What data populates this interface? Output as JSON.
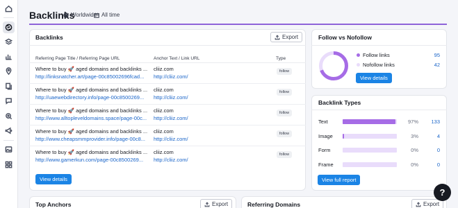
{
  "header": {
    "title": "Backlinks",
    "scope": "Worldwide",
    "period": "All time"
  },
  "sidebar": {
    "icons": [
      "home-icon",
      "backlinks-icon",
      "layers-icon",
      "chart-icon",
      "pin-icon",
      "pages-icon",
      "chat-icon",
      "search-target-icon",
      "megaphone-icon",
      "image-icon",
      "grid-icon"
    ]
  },
  "backlinks": {
    "title": "Backlinks",
    "export_label": "Export",
    "columns": {
      "referring": "Referring Page Title / Referring Page URL",
      "anchor": "Anchor Text / Link URL",
      "type": "Type"
    },
    "rows": [
      {
        "title": "Where to buy 🚀 aged domains and backlinks ...",
        "url": "http://linksnatcher.art/page-00c85002696fcad...",
        "anchor": "cliiz.com",
        "link": "http://cliiz.com/",
        "type": "follow"
      },
      {
        "title": "Where to buy 🚀 aged domains and backlinks ...",
        "url": "http://uaewebdirectory.info/page-00c8500269...",
        "anchor": "cliiz.com",
        "link": "http://cliiz.com/",
        "type": "follow"
      },
      {
        "title": "Where to buy 🚀 aged domains and backlinks ...",
        "url": "http://www.alltopleveldomains.space/page-00c...",
        "anchor": "cliiz.com",
        "link": "http://cliiz.com/",
        "type": "follow"
      },
      {
        "title": "Where to buy 🚀 aged domains and backlinks ...",
        "url": "http://www.cheapsmmprovider.info/page-00c8...",
        "anchor": "cliiz.com",
        "link": "http://cliiz.com/",
        "type": "follow"
      },
      {
        "title": "Where to buy 🚀 aged domains and backlinks ...",
        "url": "http://www.gamerkun.com/page-00c8500269...",
        "anchor": "cliiz.com",
        "link": "http://cliiz.com/",
        "type": "follow"
      }
    ],
    "view_details_label": "View details"
  },
  "follow": {
    "title": "Follow vs Nofollow",
    "items": [
      {
        "label": "Follow links",
        "count": "95",
        "color": "#a66ce6"
      },
      {
        "label": "Nofollow links",
        "count": "42",
        "color": "#e9dcfb"
      }
    ],
    "view_details_label": "View details"
  },
  "types": {
    "title": "Backlink Types",
    "items": [
      {
        "label": "Text",
        "pct": "97%",
        "count": "133",
        "fraction": 0.97
      },
      {
        "label": "Image",
        "pct": "3%",
        "count": "4",
        "fraction": 0.03
      },
      {
        "label": "Form",
        "pct": "0%",
        "count": "0",
        "fraction": 0
      },
      {
        "label": "Frame",
        "pct": "0%",
        "count": "0",
        "fraction": 0
      }
    ],
    "view_report_label": "View full report"
  },
  "anchors": {
    "title": "Top Anchors",
    "export_label": "Export"
  },
  "domains": {
    "title": "Referring Domains",
    "export_label": "Export"
  },
  "help": {
    "label": "?"
  },
  "colors": {
    "accent": "#8d62d8",
    "primary": "#1b84e5",
    "link": "#1a65c9",
    "follow": "#a66ce6",
    "nofollow": "#e9dcfb"
  }
}
